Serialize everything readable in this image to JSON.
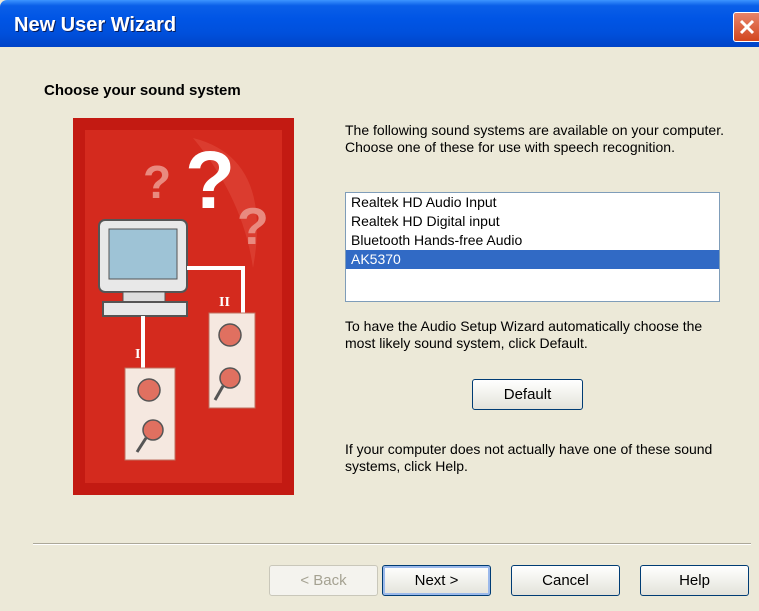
{
  "window": {
    "title": "New User Wizard"
  },
  "page": {
    "heading": "Choose your sound system",
    "intro": "The following sound systems are available on your computer. Choose one of these for use with speech recognition.",
    "default_hint": "To have the Audio Setup Wizard automatically choose the most likely sound system, click Default.",
    "help_hint": "If your computer does not actually have one of these sound systems, click Help."
  },
  "sound_systems": {
    "items": [
      {
        "label": "Realtek HD Audio Input",
        "selected": false
      },
      {
        "label": "Realtek HD Digital input",
        "selected": false
      },
      {
        "label": "Bluetooth Hands-free Audio",
        "selected": false
      },
      {
        "label": "AK5370",
        "selected": true
      }
    ]
  },
  "buttons": {
    "default": "Default",
    "back": "< Back",
    "next": "Next >",
    "cancel": "Cancel",
    "help": "Help"
  },
  "illustration": {
    "labels": {
      "channel_one": "I",
      "channel_two": "II"
    }
  },
  "colors": {
    "title_bar": "#0055e5",
    "dialog_bg": "#ece9d8",
    "selection": "#316ac5",
    "illustration_red": "#d42a1e",
    "close_button": "#d2461e"
  }
}
